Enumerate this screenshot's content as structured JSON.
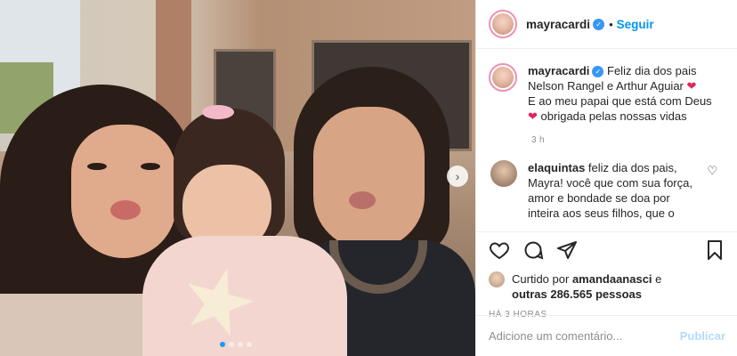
{
  "post": {
    "author": "mayracardi",
    "follow_label": "Seguir",
    "separator": "•",
    "caption_lines": [
      "Feliz dia dos pais",
      "Nelson Rangel e Arthur Aguiar",
      "E ao meu papai que está com Deus",
      "obrigada pelas nossas vidas"
    ],
    "caption_time": "3 h",
    "heart_glyph": "❤"
  },
  "comments": [
    {
      "user": "elaquintas",
      "text": "feliz dia dos pais, Mayra! você que com sua força, amor e bondade se doa por inteira aos seus filhos, que o"
    }
  ],
  "actions": {
    "liked_by_prefix": "Curtido por",
    "liked_by_user": "amandaanasci",
    "liked_by_conj": "e",
    "liked_by_others": "outras 286.565 pessoas",
    "posted_time": "HÁ 3 HORAS"
  },
  "add_comment": {
    "placeholder": "Adicione um comentário...",
    "publish_label": "Publicar"
  },
  "carousel": {
    "total_slides": 4,
    "active_slide": 1
  },
  "colors": {
    "link_blue": "#0095f6",
    "verified_blue": "#3897f0",
    "heart_red": "#e0245e",
    "publish_disabled": "#b3dbff"
  }
}
